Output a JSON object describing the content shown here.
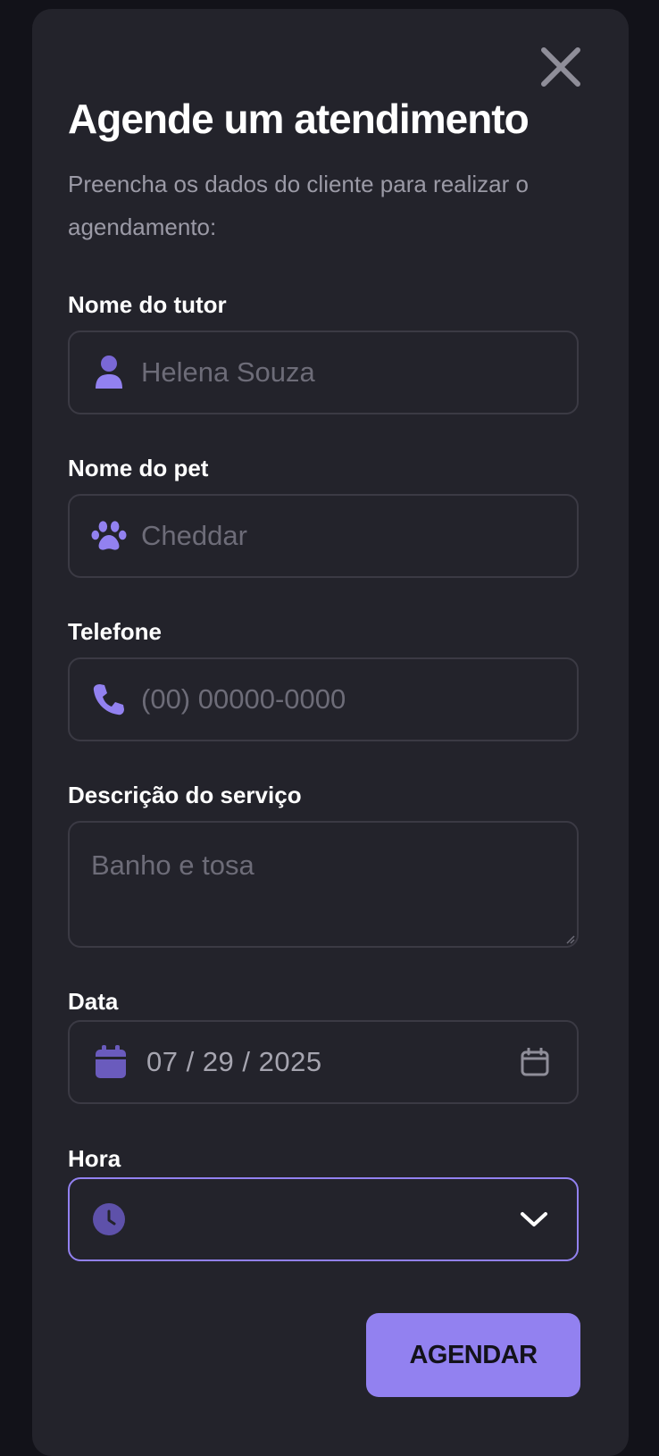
{
  "modal": {
    "title": "Agende um atendimento",
    "subtitle": "Preencha os dados do cliente para realizar o agendamento:"
  },
  "fields": {
    "tutor": {
      "label": "Nome do tutor",
      "placeholder": "Helena Souza",
      "icon": "user-icon"
    },
    "pet": {
      "label": "Nome do pet",
      "placeholder": "Cheddar",
      "icon": "paw-icon"
    },
    "phone": {
      "label": "Telefone",
      "placeholder": "(00) 00000-0000",
      "icon": "phone-icon"
    },
    "description": {
      "label": "Descrição do serviço",
      "placeholder": "Banho e tosa"
    },
    "date": {
      "label": "Data",
      "value": "07 / 29 / 2025",
      "icon": "calendar-icon"
    },
    "time": {
      "label": "Hora",
      "value": "",
      "icon": "clock-icon"
    }
  },
  "actions": {
    "submit_label": "AGENDAR"
  },
  "colors": {
    "background": "#121219",
    "modal": "#23232b",
    "accent": "#9281f0",
    "border": "#3b3a44",
    "placeholder": "#6d6c78"
  }
}
